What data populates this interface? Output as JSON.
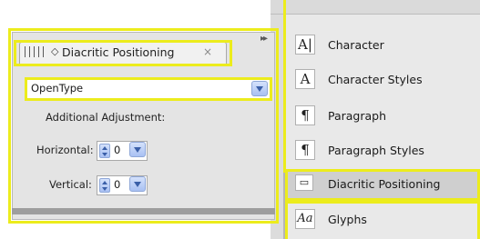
{
  "panel": {
    "tab_title": "Diacritic Positioning",
    "tab_icon": "diamond-icon",
    "close_glyph": "×",
    "collapse_glyph": "▸▸",
    "opentype_value": "OpenType",
    "additional_adjustment_label": "Additional Adjustment:",
    "horizontal_label": "Horizontal:",
    "horizontal_value": "0",
    "vertical_label": "Vertical:",
    "vertical_value": "0"
  },
  "dock": {
    "items": [
      {
        "label": "Character",
        "icon_glyph": "A|",
        "icon": "character-icon"
      },
      {
        "label": "Character Styles",
        "icon_glyph": "A",
        "icon": "character-styles-icon"
      },
      {
        "label": "Paragraph",
        "icon_glyph": "¶",
        "icon": "paragraph-icon"
      },
      {
        "label": "Paragraph Styles",
        "icon_glyph": "¶",
        "icon": "paragraph-styles-icon"
      },
      {
        "label": "Diacritic Positioning",
        "icon_glyph": "▭",
        "icon": "diacritic-positioning-icon"
      },
      {
        "label": "Glyphs",
        "icon_glyph": "Aa",
        "icon": "glyphs-icon"
      }
    ]
  },
  "colors": {
    "highlight_outline": "#ecec1c",
    "panel_bg": "#e4e4e4",
    "selected_item_bg": "#cfcfcf"
  }
}
